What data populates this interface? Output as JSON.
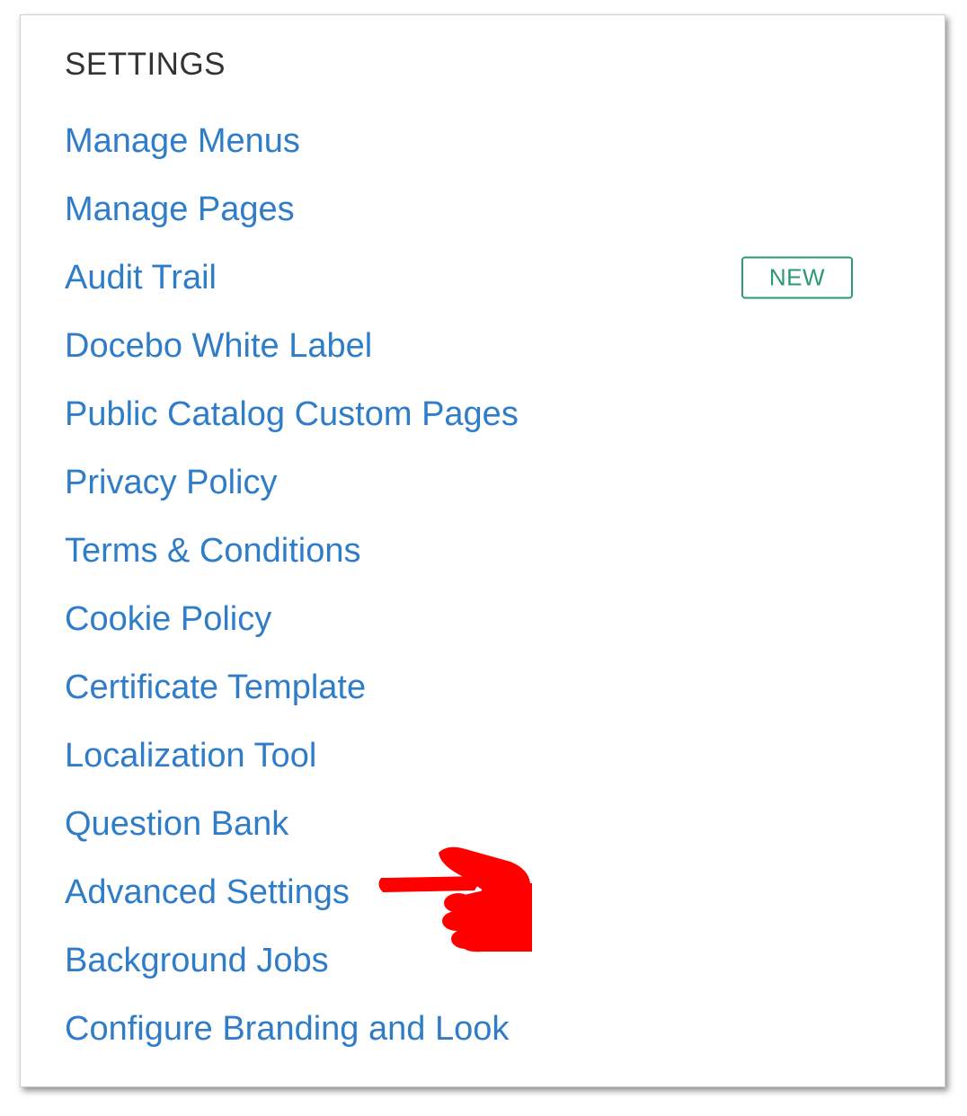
{
  "section": {
    "heading": "SETTINGS"
  },
  "menu": {
    "items": [
      {
        "label": "Manage Menus"
      },
      {
        "label": "Manage Pages"
      },
      {
        "label": "Audit Trail",
        "badge": "NEW"
      },
      {
        "label": "Docebo White Label"
      },
      {
        "label": "Public Catalog Custom Pages"
      },
      {
        "label": "Privacy Policy"
      },
      {
        "label": "Terms & Conditions"
      },
      {
        "label": "Cookie Policy"
      },
      {
        "label": "Certificate Template"
      },
      {
        "label": "Localization Tool"
      },
      {
        "label": "Question Bank"
      },
      {
        "label": "Advanced Settings"
      },
      {
        "label": "Background Jobs"
      },
      {
        "label": "Configure Branding and Look"
      }
    ]
  },
  "annotation": {
    "icon": "pointing-hand-icon",
    "color": "#ff0000",
    "target": "Advanced Settings"
  },
  "colors": {
    "link": "#2f7dc9",
    "heading": "#333333",
    "badge": "#2a9a72"
  }
}
